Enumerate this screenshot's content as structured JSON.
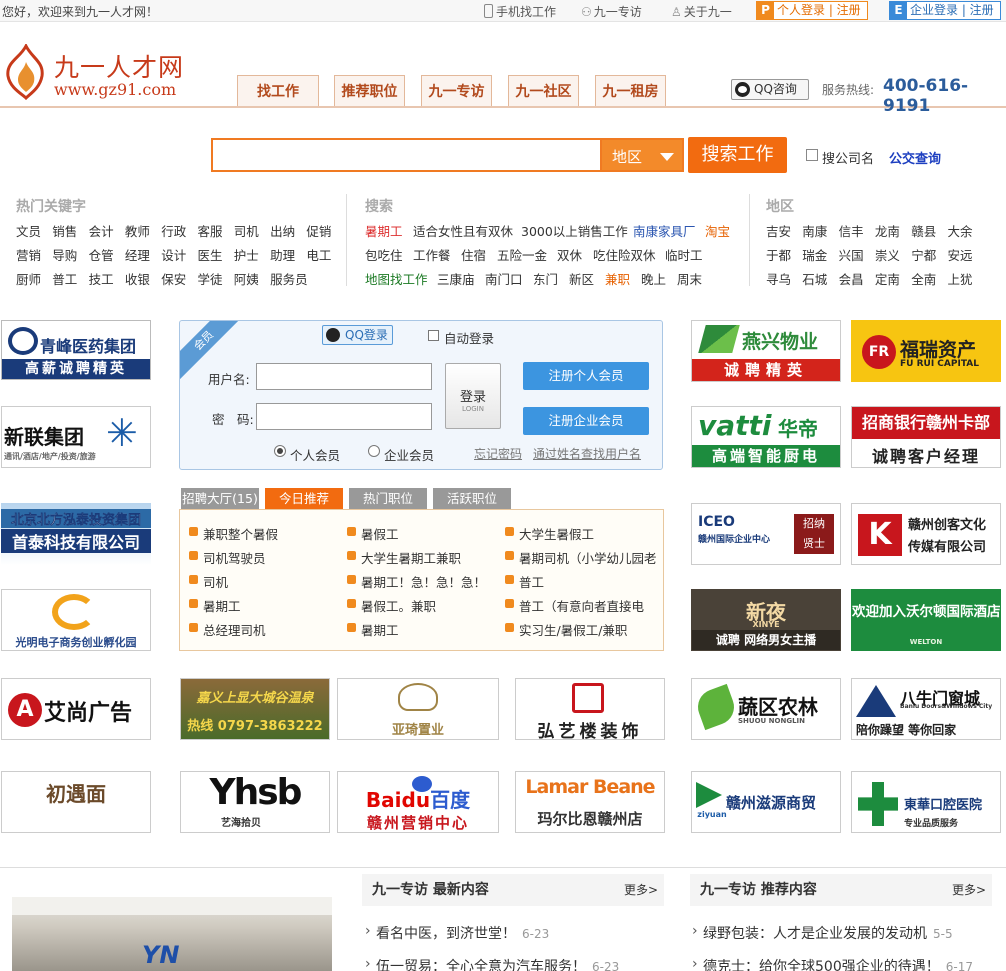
{
  "topbar": {
    "welcome": "您好，欢迎来到九一人才网！",
    "mobile": "手机找工作",
    "zhuanfang": "九一专访",
    "about": "关于九一",
    "personal_login": "个人登录 | 注册",
    "company_login": "企业登录 | 注册",
    "personal_icon": "P",
    "company_icon": "E"
  },
  "header": {
    "logo_cn": "九一人才网",
    "logo_url": "www.gz91.com",
    "tabs": [
      "找工作",
      "推荐职位",
      "九一专访",
      "九一社区",
      "九一租房"
    ],
    "qq_label": "QQ咨询",
    "hotline_label": "服务热线:",
    "hotline_number": "400-616-9191"
  },
  "search": {
    "region_label": "地区",
    "button": "搜索工作",
    "company_checkbox": "搜公司名",
    "bus_link": "公交查询"
  },
  "keywords": {
    "hot_title": "热门关键字",
    "hot": [
      [
        "文员",
        "销售",
        "会计",
        "教师",
        "行政",
        "客服",
        "司机",
        "出纳",
        "促销"
      ],
      [
        "营销",
        "导购",
        "仓管",
        "经理",
        "设计",
        "医生",
        "护士",
        "助理",
        "电工"
      ],
      [
        "厨师",
        "普工",
        "技工",
        "收银",
        "保安",
        "学徒",
        "阿姨",
        "服务员"
      ]
    ],
    "search_title": "搜索",
    "search_rows": [
      [
        "暑期工",
        "适合女性且有双休",
        "3000以上销售工作",
        "南康家具厂",
        "淘宝"
      ],
      [
        "包吃住",
        "工作餐",
        "住宿",
        "五险一金",
        "双休",
        "吃住险双休",
        "临时工"
      ],
      [
        "地图找工作",
        "三康庙",
        "南门口",
        "东门",
        "新区",
        "兼职",
        "晚上",
        "周末"
      ]
    ],
    "region_title": "地区",
    "regions": [
      [
        "吉安",
        "南康",
        "信丰",
        "龙南",
        "赣县",
        "大余"
      ],
      [
        "于都",
        "瑞金",
        "兴国",
        "崇义",
        "宁都",
        "安远"
      ],
      [
        "寻乌",
        "石城",
        "会昌",
        "定南",
        "全南",
        "上犹"
      ]
    ]
  },
  "login": {
    "corner": "会员",
    "qq": "QQ登录",
    "auto": "自动登录",
    "user_label": "用户名:",
    "pwd_label": "密　码:",
    "login_btn": "登录",
    "login_sub": "LOGIN",
    "reg_personal": "注册个人会员",
    "reg_company": "注册企业会员",
    "radio_personal": "个人会员",
    "radio_company": "企业会员",
    "forgot": "忘记密码",
    "find_user": "通过姓名查找用户名"
  },
  "jobs": {
    "tabs": [
      "招聘大厅(15)",
      "今日推荐",
      "热门职位",
      "活跃职位"
    ],
    "col1": [
      "兼职整个暑假",
      "司机驾驶员",
      "司机",
      "暑期工",
      "总经理司机"
    ],
    "col2": [
      "暑假工",
      "大学生暑期工兼职",
      "暑期工！急！急！急！",
      "暑假工。兼职",
      "暑期工"
    ],
    "col3": [
      "大学生暑假工",
      "暑期司机（小学幼儿园老",
      "普工",
      "普工（有意向者直接电",
      "实习生/暑假工/兼职"
    ]
  },
  "ads": {
    "a1": {
      "title": "青峰医药集团",
      "sub": "高薪诚聘精英"
    },
    "a2": {
      "title": "新联集团",
      "sub": "通讯/酒店/地产/投资/旅游"
    },
    "a3": {
      "title": "北京北方泓泰投资集团",
      "sub": "首泰科技有限公司"
    },
    "a4": {
      "title": "光明电子商务创业孵化园"
    },
    "a5": {
      "title": "燕兴物业",
      "sub": "诚聘精英"
    },
    "a6": {
      "title": "福瑞资产",
      "sub": "FU RUI CAPITAL"
    },
    "a7": {
      "title": "华帝",
      "sub": "高端智能厨电",
      "brand": "vatti"
    },
    "a8": {
      "title": "招商银行赣州卡部",
      "sub": "诚聘客户经理"
    },
    "a9": {
      "title": "赣州国际企业中心",
      "sub": "招纳贤士",
      "brand": "ICEO"
    },
    "a10": {
      "title": "赣州创客文化",
      "sub": "传媒有限公司"
    },
    "a11": {
      "title": "新夜",
      "sub": "诚聘 网络男女主播",
      "brand": "XINYE"
    },
    "a12": {
      "title": "欢迎加入沃尔顿国际酒店",
      "sub": "WELTON"
    },
    "a13": {
      "title": "艾尚广告"
    },
    "a14": {
      "title": "嘉义上显大城谷温泉",
      "sub": "热线 0797-3863222"
    },
    "a15": {
      "title": "亚琦置业"
    },
    "a16": {
      "title": "弘艺楼装饰"
    },
    "a17": {
      "title": "蔬区农林",
      "sub": "SHUOU NONGLIN"
    },
    "a18": {
      "title": "八牛门窗城",
      "sub": "陪你躁望 等你回家",
      "brand": "Baniu Doors&Windows City"
    },
    "a19": {
      "title": "初遇面",
      "sub": "面"
    },
    "a20": {
      "title": "Yhsb",
      "sub": "艺海拾贝"
    },
    "a21": {
      "title": "百度",
      "sub": "赣州营销中心",
      "brand": "Baidu"
    },
    "a22": {
      "title": "玛尔比恩赣州店",
      "brand": "Lamar Beane"
    },
    "a23": {
      "title": "赣州滋源商贸",
      "brand": "ziyuan"
    },
    "a24": {
      "title": "東華口腔医院",
      "sub": "专业品质服务"
    }
  },
  "news": {
    "latest_title": "九一专访 最新内容",
    "recommend_title": "九一专访 推荐内容",
    "more": "更多>",
    "photo_text": "YN",
    "latest": [
      {
        "title": "看名中医，到济世堂！",
        "date": "6-23"
      },
      {
        "title": "伍一贸易：全心全意为汽车服务！",
        "date": "6-23"
      }
    ],
    "recommend": [
      {
        "title": "绿野包装：人才是企业发展的发动机",
        "date": "5-5"
      },
      {
        "title": "德克士：给你全球500强企业的待遇！",
        "date": "6-17"
      }
    ]
  },
  "colors": {
    "accent": "#f26b10",
    "nav_text": "#b24a1d",
    "link_blue": "#2a55b0"
  }
}
